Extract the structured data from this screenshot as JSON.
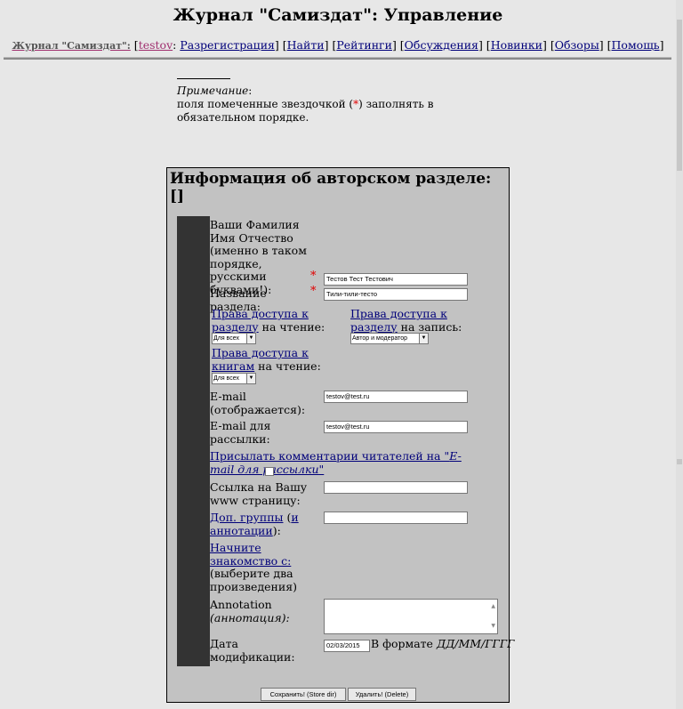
{
  "page": {
    "title": "Журнал \"Самиздат\": Управление"
  },
  "nav": {
    "brand": "Журнал \"Самиздат\":",
    "user": "testov",
    "items": [
      "Разрегистрация",
      "Найти",
      "Рейтинги",
      "Обсуждения",
      "Новинки",
      "Обзоры",
      "Помощь"
    ]
  },
  "note": {
    "heading": "Примечание",
    "text_before": "поля помеченные звездочкой (",
    "star": "*",
    "text_after": ") заполнять в обязательном порядке."
  },
  "form": {
    "heading": "Информация об авторском разделе: []",
    "fio_label": "Ваши Фамилия Имя Отчество (именно в таком порядке, русскими буквами!):",
    "fio_value": "Тестов Тест Тестович",
    "section_label": "Название раздела:",
    "section_value": "Тили-тили-тесто",
    "required_mark": "*",
    "read_access_link": "Права доступа к разделу",
    "read_access_suffix": " на чтение:",
    "read_access_value": "Для всех",
    "write_access_link": "Права доступа к разделу",
    "write_access_suffix": " на запись:",
    "write_access_value": "Автор и модератор",
    "books_access_link": "Права доступа к книгам",
    "books_access_suffix": " на чтение:",
    "books_access_value": "Для всех",
    "email_label": "E-mail (отображается):",
    "email_value": "testov@test.ru",
    "email2_label": "E-mail для рассылки:",
    "email2_value": "testov@test.ru",
    "comments_link_a": "Присылать комментарии читателей на \"",
    "comments_link_b": "E-mail для рассылки",
    "comments_link_c": "\"",
    "url_label": "Ссылка на Вашу www страницу:",
    "url_value": "",
    "groups_link": "Доп. группы",
    "groups_mid": " (",
    "groups_link2": "и аннотации",
    "groups_end": "):",
    "groups_value": "",
    "start_link": "Начните знакомство с:",
    "start_hint": "(выберите два произведения)",
    "annotation_label": "Annotation",
    "annotation_label2": "(аннотация):",
    "date_label": "Дата модификации:",
    "date_value": "02/03/2015",
    "date_format_prefix": "В формате ",
    "date_format": "ДД/ММ/ГГГГ",
    "save_button": "Сохранить! (Store dir)",
    "delete_button": "Удалить! (Delete)"
  }
}
